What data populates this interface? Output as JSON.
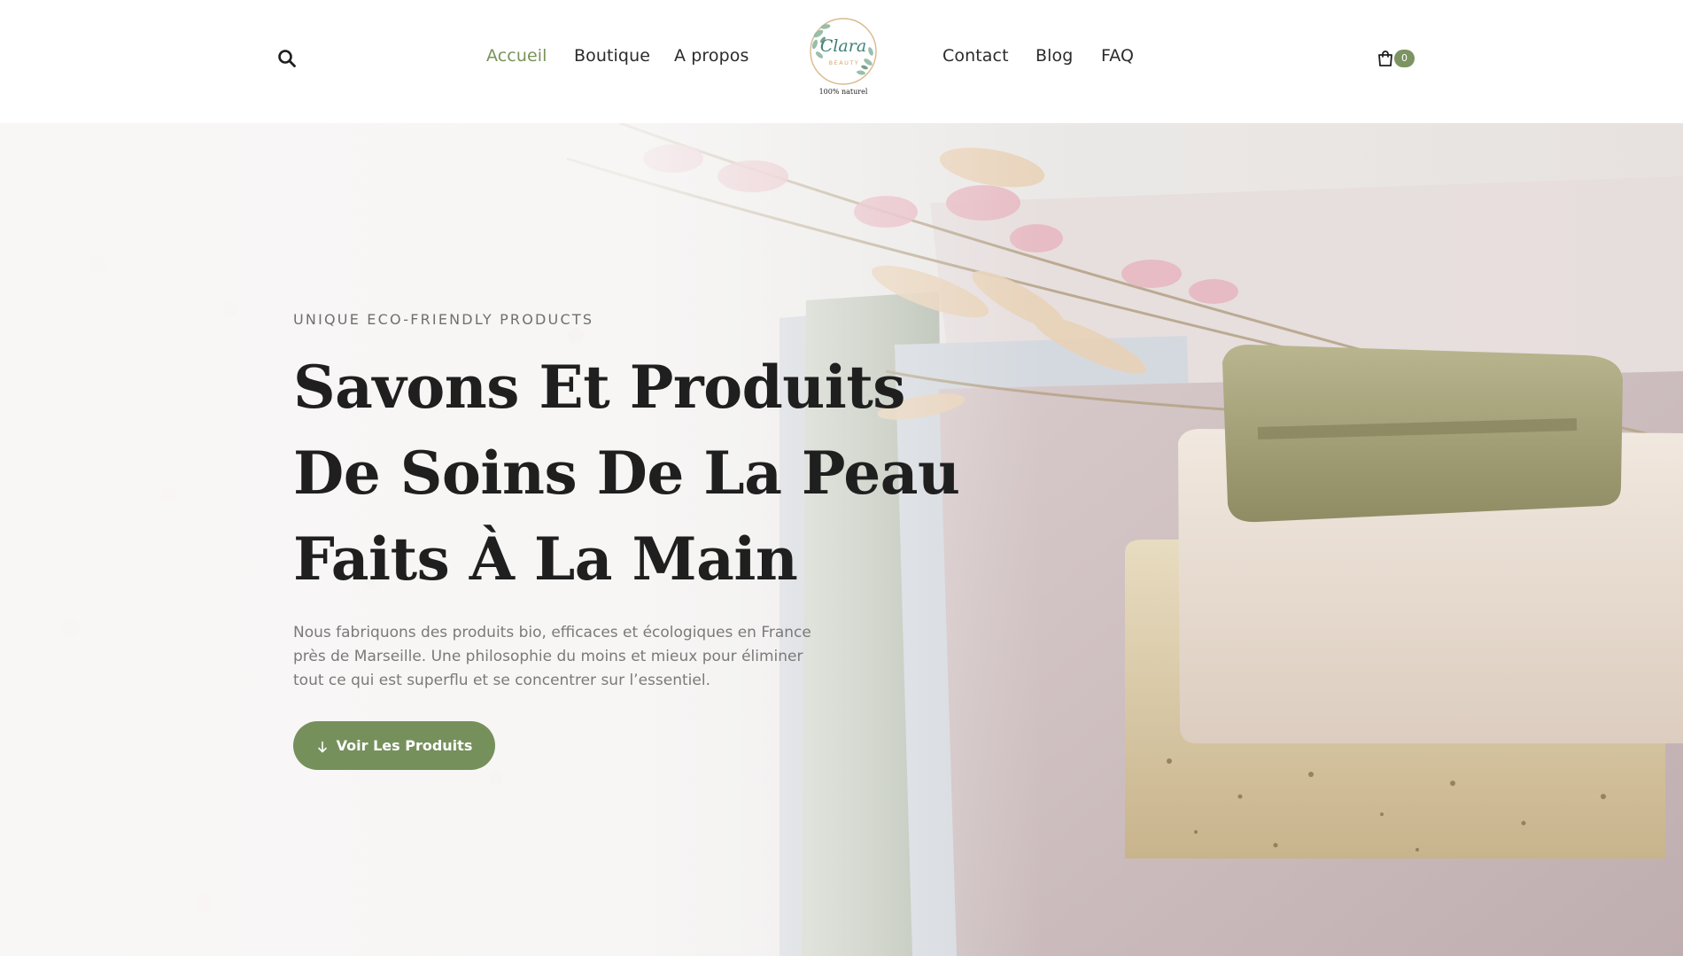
{
  "header": {
    "nav_left": [
      {
        "label": "Accueil",
        "active": true
      },
      {
        "label": "Boutique",
        "active": false
      },
      {
        "label": "A propos",
        "active": false
      }
    ],
    "nav_right": [
      {
        "label": "Contact",
        "active": false
      },
      {
        "label": "Blog",
        "active": false
      },
      {
        "label": "FAQ",
        "active": false
      }
    ],
    "logo": {
      "script_text": "Clara",
      "sub_text": "BEAUTY",
      "tagline": "100% naturel"
    },
    "cart_count": "0",
    "search_icon": "search-icon",
    "cart_icon": "shopping-bag-icon"
  },
  "hero": {
    "eyebrow": "UNIQUE ECO-FRIENDLY PRODUCTS",
    "title_lines": [
      "Savons Et Produits",
      "De Soins De La Peau",
      "Faits À La Main"
    ],
    "description": "Nous fabriquons des produits bio, efficaces et écologiques en France près de Marseille. Une philosophie du moins et mieux pour éliminer tout ce qui est superflu et se concentrer sur l’essentiel.",
    "cta_label": "Voir Les Produits",
    "cta_icon": "arrow-down-icon"
  },
  "colors": {
    "accent": "#78935a",
    "button": "#76905c",
    "text_dark": "#1f1f1f",
    "text_muted": "#7a7a7a"
  }
}
